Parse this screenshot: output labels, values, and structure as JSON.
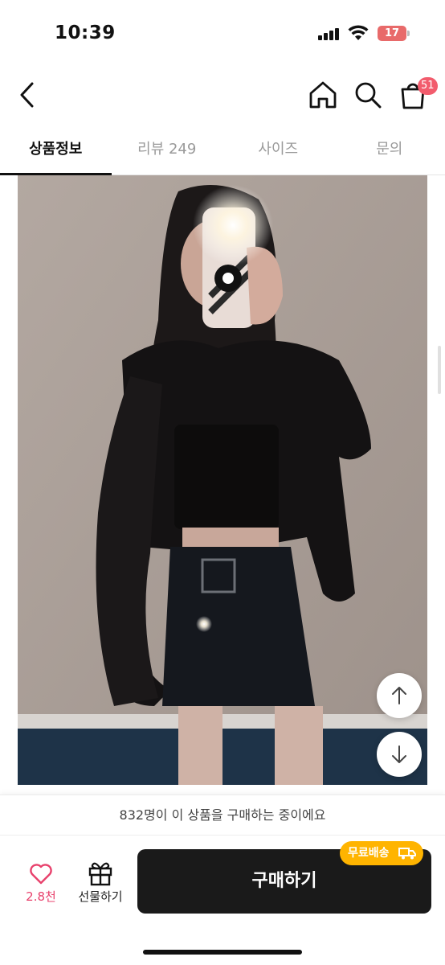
{
  "status_bar": {
    "time": "10:39",
    "battery": "17"
  },
  "header": {
    "cart_badge": "51"
  },
  "tabs": [
    {
      "label": "상품정보",
      "active": true
    },
    {
      "label": "리뷰 249",
      "active": false
    },
    {
      "label": "사이즈",
      "active": false
    },
    {
      "label": "문의",
      "active": false
    }
  ],
  "bottom": {
    "buyers_text": "832명이 이 상품을 구매하는 중이에요",
    "like_count": "2.8천",
    "gift_label": "선물하기",
    "buy_label": "구매하기",
    "free_shipping": "무료배송"
  },
  "colors": {
    "accent_pink": "#f25c6d",
    "like_pink": "#e8416c",
    "buy_button": "#1a1a1a",
    "free_shipping_badge": "#ffb400"
  }
}
